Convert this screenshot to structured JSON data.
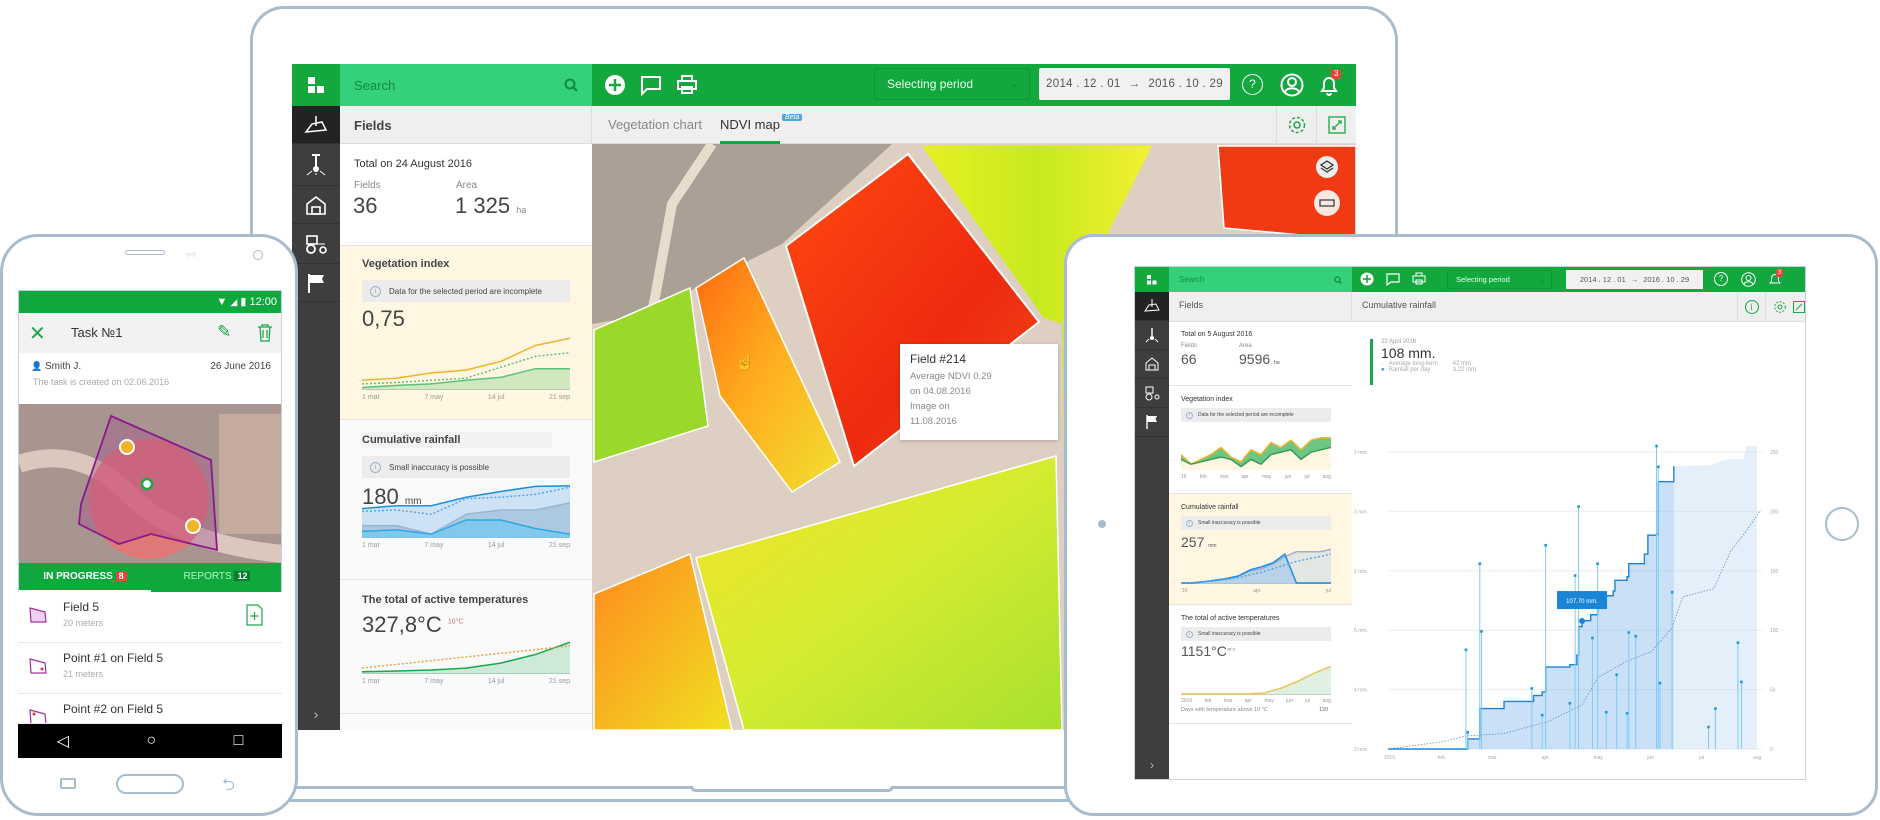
{
  "colors": {
    "brand_dark": "#12a83d",
    "brand_light": "#33d27a",
    "rail": "#3e3e3e",
    "alert": "#e8443a",
    "rain_blue": "#1a9be0",
    "veg_orange": "#f0b429"
  },
  "laptop": {
    "search": {
      "placeholder": "Search",
      "icon": "search-icon"
    },
    "toolbar": {
      "add_icon": "plus-circle-icon",
      "comment_icon": "chat-icon",
      "print_icon": "printer-icon",
      "period_select": "Selecting period",
      "date_from": "2014 . 12 . 01",
      "date_arrow": "→",
      "date_to": "2016 . 10 . 29",
      "help_icon": "help-icon",
      "user_icon": "user-icon",
      "notifications_count": "3"
    },
    "rail": [
      "fields-icon",
      "soil-sampling-icon",
      "storage-icon",
      "machinery-icon",
      "weather-flag-icon"
    ],
    "panel": {
      "title": "Fields",
      "totals": {
        "heading": "Total on 24 August 2016",
        "fields_label": "Fields",
        "fields_value": "36",
        "area_label": "Area",
        "area_value": "1 325",
        "area_unit": "ha"
      },
      "vegetation": {
        "title": "Vegetation index",
        "notice": "Data for the selected period are incomplete",
        "value": "0,75",
        "ticks": [
          "1 mar",
          "7 may",
          "14 jul",
          "21 sep"
        ],
        "series": [
          {
            "values": [
              0.02,
              0.05,
              0.07,
              0.12,
              0.16,
              0.28,
              0.28
            ],
            "stroke": "#5cc27a",
            "fill": "rgba(120,200,130,0.35)"
          },
          {
            "values": [
              0.12,
              0.15,
              0.22,
              0.26,
              0.38,
              0.6,
              0.7
            ],
            "stroke": "#f0b429",
            "fill": "none"
          },
          {
            "values": [
              0.07,
              0.09,
              0.12,
              0.15,
              0.3,
              0.45,
              0.5
            ],
            "stroke": "#5cc27a",
            "dash": true
          }
        ],
        "ymax": 0.8
      },
      "rainfall": {
        "title": "Cumulative rainfall",
        "notice": "Small inaccuracy is possible",
        "value": "180",
        "unit": "mm",
        "ticks": [
          "1 mar",
          "7 may",
          "14 jul",
          "21 sep"
        ],
        "series": [
          {
            "values": [
              40,
              40,
              10,
              80,
              95,
              95,
              120
            ],
            "stroke": "#a9b8c6",
            "fill": "rgba(170,185,200,0.6)"
          },
          {
            "values": [
              100,
              110,
              110,
              140,
              160,
              178,
              180
            ],
            "stroke": "#1a8fe0",
            "fill": "rgba(120,180,235,0.35)"
          },
          {
            "values": [
              90,
              95,
              80,
              135,
              140,
              150,
              175
            ],
            "stroke": "#5aa6e6",
            "dash": true
          },
          {
            "values": [
              20,
              25,
              10,
              60,
              60,
              30,
              10
            ],
            "stroke": "#2aa9e8",
            "fill": "rgba(110,200,240,0.7)"
          }
        ],
        "ymax": 190
      },
      "temperature": {
        "title": "The total of active temperatures",
        "value": "327,8°C",
        "threshold": "10°C",
        "ticks": [
          "1 mar",
          "7 may",
          "14 jul",
          "21 sep"
        ],
        "series": [
          {
            "values": [
              5,
              8,
              12,
              20,
              40,
              75,
              125
            ],
            "stroke": "#1aa84a",
            "fill": "rgba(120,200,150,0.35)"
          },
          {
            "values": [
              20,
              35,
              50,
              65,
              80,
              95,
              110
            ],
            "stroke": "#f0a040",
            "dash": true
          }
        ],
        "ymax": 130
      }
    },
    "tabs": [
      {
        "label": "Vegetation chart",
        "active": false
      },
      {
        "label": "NDVI map",
        "active": true,
        "badge": "Beta"
      }
    ],
    "map": {
      "tooltip": {
        "title": "Field #214",
        "line1": "Average NDVI 0.29",
        "line2": "on 04.08.2016",
        "line3": "Image on",
        "line4": "11.08.2016"
      },
      "layers_icon": "layers-icon",
      "ruler_icon": "ruler-icon"
    }
  },
  "tablet": {
    "search": {
      "placeholder": "Search"
    },
    "toolbar": {
      "period_select": "Selecting period",
      "date_from": "2014 . 12 . 01",
      "date_arrow": "→",
      "date_to": "2016 . 10 . 29",
      "notifications_count": "3"
    },
    "panel": {
      "title": "Fields",
      "totals": {
        "heading": "Total on 5 August 2016",
        "fields_label": "Fields",
        "fields_value": "66",
        "area_label": "Area",
        "area_value": "9596",
        "area_unit": "ha"
      },
      "vegetation": {
        "title": "Vegetation index",
        "notice": "Data for the selected period are incomplete",
        "ticks": [
          "16",
          "feb",
          "mar",
          "apr",
          "may",
          "jun",
          "jul",
          "aug"
        ],
        "series": [
          {
            "values": [
              0.3,
              0.1,
              0.2,
              0.3,
              0.45,
              0.25,
              0.15,
              0.4,
              0.3,
              0.55,
              0.45,
              0.6,
              0.4,
              0.6,
              0.65,
              0.65
            ],
            "stroke": "#f0b429",
            "fill": "rgba(60,180,90,0.75)"
          },
          {
            "values": [
              0.2,
              0.1,
              0.15,
              0.2,
              0.25,
              0.2,
              0.05,
              0.2,
              0.1,
              0.3,
              0.35,
              0.4,
              0.2,
              0.35,
              0.4,
              0.45
            ],
            "stroke": "#3a9a5a",
            "fill": "rgba(255,247,226,1)"
          }
        ],
        "ymax": 0.75
      },
      "rainfall": {
        "title": "Cumulative rainfall",
        "notice": "Small inaccuracy is possible",
        "value": "257",
        "unit": "mm",
        "ticks": [
          "'16",
          "apr",
          "jul"
        ],
        "series": [
          {
            "values": [
              0,
              0,
              5,
              10,
              20,
              30,
              50,
              60,
              80,
              110,
              130,
              130,
              130,
              140
            ],
            "stroke": "#aac",
            "fill": "rgba(200,215,230,0.5)"
          },
          {
            "values": [
              0,
              0,
              5,
              12,
              18,
              30,
              55,
              68,
              85,
              120,
              0,
              0,
              0,
              0
            ],
            "stroke": "#1a8fe0",
            "fill": "rgba(120,180,235,0.4)"
          },
          {
            "values": [
              0,
              2,
              6,
              10,
              15,
              22,
              35,
              45,
              60,
              75,
              90,
              100,
              110,
              120
            ],
            "stroke": "#5aa6e6",
            "dash": true
          }
        ],
        "ymax": 150
      },
      "temperature": {
        "title": "The total of active temperatures",
        "notice": "Small inaccuracy is possible",
        "value": "1151°C",
        "threshold": "10°C",
        "ticks": [
          "2016",
          "feb",
          "mar",
          "apr",
          "may",
          "jun",
          "jul",
          "aug"
        ],
        "footer_label": "Days with temperature above 10 °C",
        "footer_value": "120",
        "series": [
          {
            "values": [
              0,
              0,
              0,
              0,
              0,
              5,
              25,
              55,
              90,
              120
            ],
            "stroke": "#f0c060",
            "fill": "rgba(170,215,170,0.35)"
          }
        ],
        "ymax": 130
      }
    },
    "main": {
      "title": "Cumulative rainfall",
      "legend": {
        "date": "22 April 2016",
        "value": "108 mm.",
        "avg_label": "Average long-term",
        "avg_value": "42 mm.",
        "daily_label": "Rainfall per day",
        "daily_value": "3.22 mm."
      },
      "tooltip": "107.70 mm."
    }
  },
  "chart_data": {
    "type": "area",
    "title": "Cumulative rainfall",
    "x_ticks": [
      "2016",
      "feb",
      "mar",
      "apr",
      "may",
      "jun",
      "jul",
      "aug"
    ],
    "y_left_ticks": [
      "3 mm.",
      "3 mm.",
      "2 mm.",
      "5 mm.",
      "4 mm.",
      "3 mm."
    ],
    "y_right_ticks": [
      "250",
      "200",
      "150",
      "100",
      "50",
      "0"
    ],
    "y_right_range": [
      0,
      250
    ],
    "grid": true,
    "cumulative": [
      [
        "2016-01-01",
        0
      ],
      [
        "2016-02-15",
        0
      ],
      [
        "2016-02-16",
        8.5
      ],
      [
        "2016-02-23",
        34
      ],
      [
        "2016-03-08",
        40
      ],
      [
        "2016-03-24",
        40
      ],
      [
        "2016-03-25",
        45
      ],
      [
        "2016-03-30",
        48
      ],
      [
        "2016-04-01",
        69
      ],
      [
        "2016-04-15",
        71
      ],
      [
        "2016-04-19",
        79
      ],
      [
        "2016-04-20",
        103
      ],
      [
        "2016-04-22",
        108
      ],
      [
        "2016-04-27",
        113
      ],
      [
        "2016-05-01",
        129
      ],
      [
        "2016-05-10",
        133
      ],
      [
        "2016-05-11",
        142
      ],
      [
        "2016-05-18",
        145
      ],
      [
        "2016-05-19",
        156
      ],
      [
        "2016-05-28",
        164
      ],
      [
        "2016-05-30",
        180
      ],
      [
        "2016-06-04",
        181
      ],
      [
        "2016-06-05",
        225
      ],
      [
        "2016-06-12",
        225
      ],
      [
        "2016-06-14",
        238
      ]
    ],
    "forecast": [
      [
        "2016-06-14",
        238
      ],
      [
        "2016-07-05",
        239
      ],
      [
        "2016-07-15",
        244
      ],
      [
        "2016-07-24",
        244
      ],
      [
        "2016-07-26",
        255
      ],
      [
        "2016-08-01",
        255
      ]
    ],
    "average_long_term": [
      [
        "2016-01-01",
        0
      ],
      [
        "2016-02-01",
        6
      ],
      [
        "2016-02-15",
        11
      ],
      [
        "2016-03-08",
        13
      ],
      [
        "2016-04-02",
        23
      ],
      [
        "2016-04-22",
        37
      ],
      [
        "2016-05-01",
        60
      ],
      [
        "2016-05-18",
        74
      ],
      [
        "2016-06-01",
        82
      ],
      [
        "2016-06-13",
        102
      ],
      [
        "2016-06-19",
        128
      ],
      [
        "2016-07-07",
        135
      ],
      [
        "2016-07-17",
        167
      ],
      [
        "2016-07-26",
        184
      ],
      [
        "2016-08-03",
        201
      ]
    ],
    "daily_rainfall": [
      [
        "2016-02-15",
        1.67
      ],
      [
        "2016-02-16",
        0.28
      ],
      [
        "2016-02-23",
        3.12
      ],
      [
        "2016-02-24",
        1.98
      ],
      [
        "2016-03-24",
        1.02
      ],
      [
        "2016-03-30",
        0.57
      ],
      [
        "2016-04-01",
        3.43
      ],
      [
        "2016-04-15",
        0.77
      ],
      [
        "2016-04-18",
        2.92
      ],
      [
        "2016-04-20",
        4.08
      ],
      [
        "2016-04-28",
        1.87
      ],
      [
        "2016-05-01",
        3.12
      ],
      [
        "2016-05-06",
        0.62
      ],
      [
        "2016-05-12",
        1.25
      ],
      [
        "2016-05-18",
        0.6
      ],
      [
        "2016-05-19",
        1.96
      ],
      [
        "2016-05-23",
        1.9
      ],
      [
        "2016-06-04",
        5.1
      ],
      [
        "2016-06-05",
        4.75
      ],
      [
        "2016-06-06",
        1.11
      ],
      [
        "2016-06-13",
        2.64
      ],
      [
        "2016-07-04",
        0.37
      ],
      [
        "2016-07-08",
        0.68
      ],
      [
        "2016-07-21",
        1.79
      ],
      [
        "2016-07-23",
        1.13
      ]
    ],
    "highlight": {
      "date": "2016-04-22",
      "label": "107.70 mm.",
      "value": 107.7
    }
  },
  "phone": {
    "status": {
      "time": "12:00"
    },
    "appbar": {
      "title": "Task №1",
      "close_icon": "close-icon",
      "edit_icon": "pencil-icon",
      "delete_icon": "trash-icon"
    },
    "task": {
      "assignee": "Smith J.",
      "due_date": "26 June 2016",
      "created": "The task is created on 02.06.2016"
    },
    "tabs": [
      {
        "label": "IN PROGRESS",
        "count": "8",
        "active": true
      },
      {
        "label": "REPORTS",
        "count": "12",
        "active": false
      }
    ],
    "items": [
      {
        "title": "Field 5",
        "subtitle": "20 meters"
      },
      {
        "title": "Point #1 on Field 5",
        "subtitle": "21 meters"
      },
      {
        "title": "Point #2 on Field 5",
        "subtitle": ""
      }
    ],
    "nav": {
      "back": "◁",
      "home": "○",
      "recent": "□"
    }
  }
}
